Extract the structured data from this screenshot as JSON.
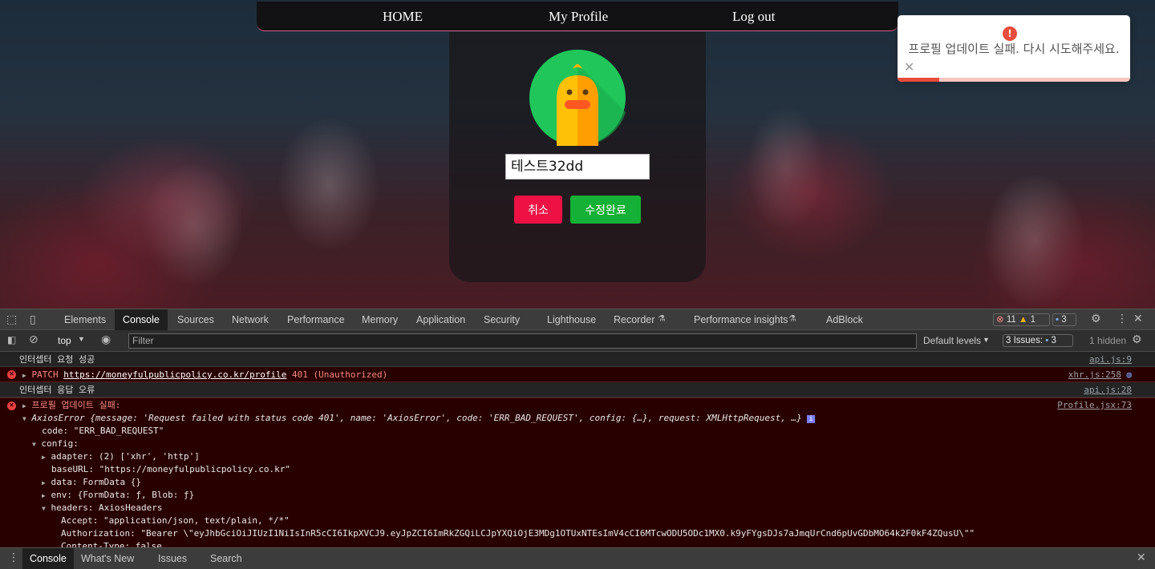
{
  "nav": {
    "home": "HOME",
    "profile": "My Profile",
    "logout": "Log out"
  },
  "profile": {
    "nickname_value": "테스트32dd",
    "cancel_label": "취소",
    "save_label": "수정완료"
  },
  "toast": {
    "icon": "!",
    "message": "프로필 업데이트 실패. 다시 시도해주세요.",
    "close": "✕",
    "progress": 0.18,
    "accent": "#e74c3c"
  },
  "devtools": {
    "tabs": [
      "Elements",
      "Console",
      "Sources",
      "Network",
      "Performance",
      "Memory",
      "Application",
      "Security",
      "Lighthouse",
      "Recorder",
      "Performance insights",
      "AdBlock"
    ],
    "errors_count": "11",
    "warnings_count": "1",
    "messages_count": "3",
    "context": "top",
    "filter_placeholder": "Filter",
    "default_levels": "Default levels",
    "issues_label": "3 Issues:",
    "issues_count": "3",
    "hidden": "1 hidden",
    "drawer_tabs": [
      "Console",
      "What's New",
      "Issues",
      "Search"
    ]
  },
  "console": {
    "l1": {
      "text": "인터셉터 요청 성공",
      "src": "api.js:9"
    },
    "l2": {
      "method": "PATCH",
      "url": "https://moneyfulpublicpolicy.co.kr/profile",
      "status": "401 (Unauthorized)",
      "src": "xhr.js:258"
    },
    "l3": {
      "text": "인터셉터 응답 오류",
      "src": "api.js:28"
    },
    "l4": {
      "text": "프로필 업데이트 실패:",
      "src": "Profile.jsx:73"
    },
    "axios_summary": "AxiosError {message: 'Request failed with status code 401', name: 'AxiosError', code: 'ERR_BAD_REQUEST', config: {…}, request: XMLHttpRequest, …}",
    "code_line": "code: \"ERR_BAD_REQUEST\"",
    "config_line": "config:",
    "adapter_line": "adapter: (2) ['xhr', 'http']",
    "baseurl_line": "baseURL: \"https://moneyfulpublicpolicy.co.kr\"",
    "data_line": "data: FormData {}",
    "env_line": "env: {FormData: ƒ, Blob: ƒ}",
    "headers_line": "headers: AxiosHeaders",
    "accept_line": "Accept: \"application/json, text/plain, */*\"",
    "auth_line": "Authorization: \"Bearer \\\"eyJhbGciOiJIUzI1NiIsInR5cCI6IkpXVCJ9.eyJpZCI6ImRkZGQiLCJpYXQiOjE3MDg1OTUxNTEsImV4cCI6MTcwODU5ODc1MX0.k9yFYgsDJs7aJmqUrCnd6pUvGDbMO64k2F0kF4ZQusU\\\"\"",
    "ctype_line": "Content-Type: false"
  }
}
